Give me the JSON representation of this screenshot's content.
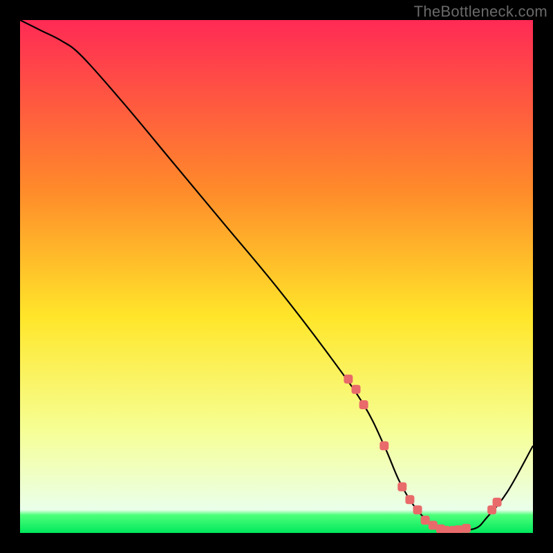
{
  "watermark": "TheBottleneck.com",
  "chart_data": {
    "type": "line",
    "title": "",
    "xlabel": "",
    "ylabel": "",
    "xlim": [
      0,
      100
    ],
    "ylim": [
      0,
      100
    ],
    "grid": false,
    "gradient_stops": [
      {
        "pct": 0,
        "color": "#ff2a55"
      },
      {
        "pct": 33,
        "color": "#ff8a2a"
      },
      {
        "pct": 58,
        "color": "#ffe62a"
      },
      {
        "pct": 80,
        "color": "#f6ff95"
      },
      {
        "pct": 95.5,
        "color": "#eaffea"
      },
      {
        "pct": 96.5,
        "color": "#4dff7a"
      },
      {
        "pct": 100,
        "color": "#00e85c"
      }
    ],
    "series": [
      {
        "name": "bottleneck-curve",
        "color": "#000000",
        "x": [
          0,
          4,
          8,
          12,
          20,
          30,
          40,
          50,
          60,
          67,
          71,
          74,
          77,
          80,
          83,
          86,
          89,
          91,
          95,
          100
        ],
        "y": [
          100,
          98,
          96,
          93,
          84,
          72,
          60,
          48,
          35,
          25,
          17,
          10,
          5,
          2,
          0.5,
          0.5,
          1,
          3,
          8,
          17
        ]
      }
    ],
    "markers": {
      "name": "highlight-points",
      "shape": "rounded-square",
      "color": "#e96a6a",
      "x": [
        64,
        65.5,
        67,
        71,
        74.5,
        76,
        77.5,
        79,
        80.5,
        82,
        83,
        84.5,
        85.5,
        87,
        92,
        93
      ],
      "y": [
        30,
        28,
        25,
        17,
        9,
        6.5,
        4.5,
        2.5,
        1.5,
        0.8,
        0.5,
        0.5,
        0.6,
        0.9,
        4.5,
        6
      ]
    }
  }
}
